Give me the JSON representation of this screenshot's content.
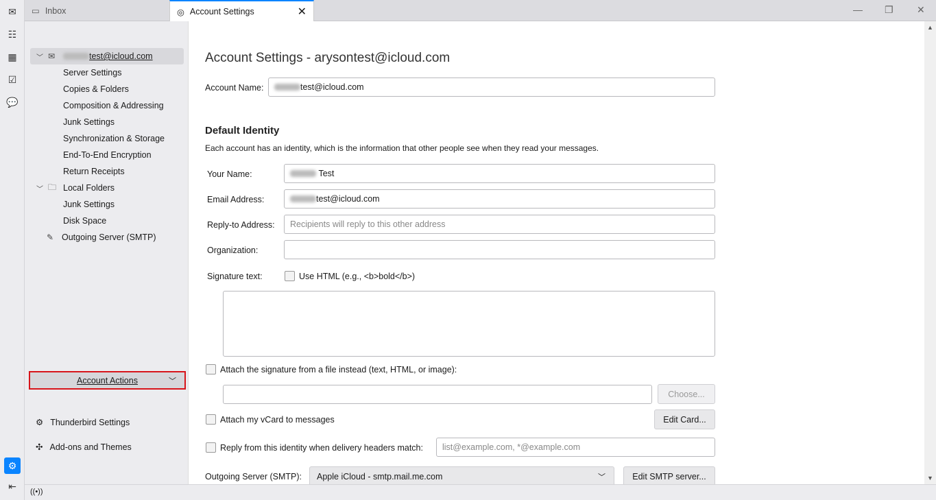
{
  "tabs": [
    {
      "label": "Inbox"
    },
    {
      "label": "Account Settings"
    }
  ],
  "sidebar": {
    "account": "test@icloud.com",
    "account_items": [
      "Server Settings",
      "Copies & Folders",
      "Composition & Addressing",
      "Junk Settings",
      "Synchronization & Storage",
      "End-To-End Encryption",
      "Return Receipts"
    ],
    "local_folders": "Local Folders",
    "local_items": [
      "Junk Settings",
      "Disk Space"
    ],
    "outgoing": "Outgoing Server (SMTP)",
    "account_actions": "Account Actions",
    "thunderbird_settings": "Thunderbird Settings",
    "addons": "Add-ons and Themes"
  },
  "main": {
    "title": "Account Settings - arysontest@icloud.com",
    "account_name_label": "Account Name:",
    "account_name_value": "test@icloud.com",
    "default_identity": "Default Identity",
    "identity_desc": "Each account has an identity, which is the information that other people see when they read your messages.",
    "your_name_label": "Your Name:",
    "your_name_value": "Test",
    "email_label": "Email Address:",
    "email_value": "test@icloud.com",
    "reply_to_label": "Reply-to Address:",
    "reply_to_placeholder": "Recipients will reply to this other address",
    "org_label": "Organization:",
    "signature_label": "Signature text:",
    "use_html": "Use HTML (e.g., <b>bold</b>)",
    "attach_sig": "Attach the signature from a file instead (text, HTML, or image):",
    "choose": "Choose...",
    "attach_vcard": "Attach my vCard to messages",
    "edit_card": "Edit Card...",
    "reply_from": "Reply from this identity when delivery headers match:",
    "reply_from_placeholder": "list@example.com, *@example.com",
    "outgoing_label": "Outgoing Server (SMTP):",
    "outgoing_value": "Apple iCloud - smtp.mail.me.com",
    "edit_smtp": "Edit SMTP server..."
  },
  "colors": {
    "accent": "#0a84ff",
    "highlight": "#d7141a"
  }
}
